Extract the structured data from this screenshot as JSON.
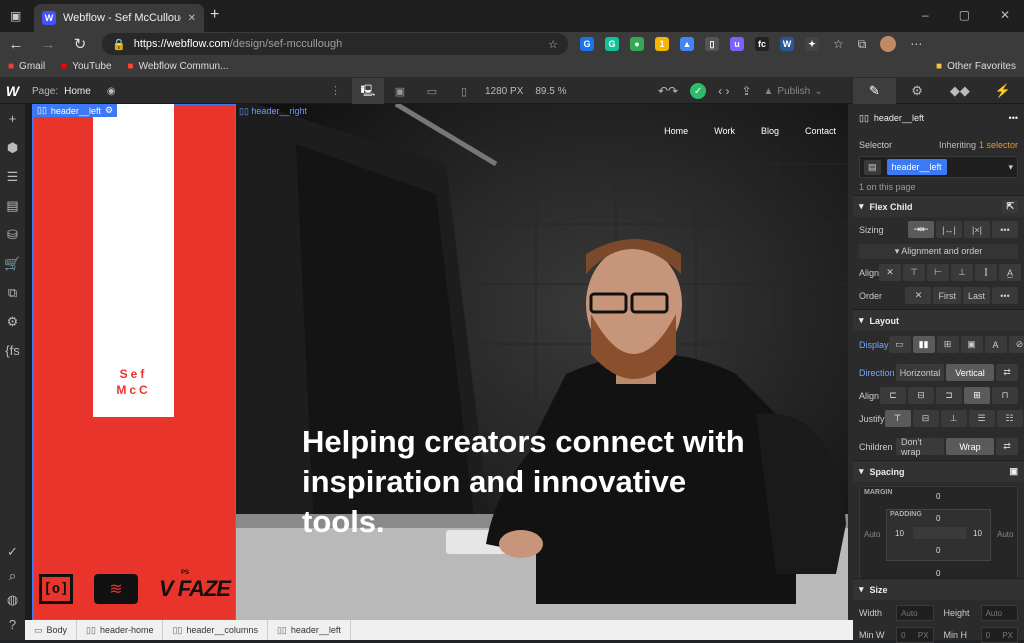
{
  "browser": {
    "tab_title": "Webflow - Sef McCullough",
    "tab_favicon": "W",
    "new_tab": "+",
    "close": "✕",
    "url_domain": "https://webflow.com",
    "url_path": "/design/sef-mccullough",
    "bookmarks": [
      {
        "label": "Gmail",
        "icon": "gmail-icon",
        "color": "#ea4335"
      },
      {
        "label": "YouTube",
        "icon": "youtube-icon",
        "color": "#ff0000"
      },
      {
        "label": "Webflow Commun...",
        "icon": "webflow-community-icon",
        "color": "#ff4433"
      }
    ],
    "other_favorites": "Other Favorites",
    "extensions": [
      {
        "icon": "g-ext-icon",
        "glyph": "G",
        "color": "#1a73e8"
      },
      {
        "icon": "grammarly-icon",
        "glyph": "G",
        "color": "#15c39a"
      },
      {
        "icon": "dot-ext-icon",
        "glyph": "●",
        "color": "#34a853"
      },
      {
        "icon": "badge-ext-icon",
        "glyph": "1",
        "color": "#f4b400"
      },
      {
        "icon": "arrow-ext-icon",
        "glyph": "▲",
        "color": "#4285f4"
      },
      {
        "icon": "phone-ext-icon",
        "glyph": "▯",
        "color": "#555555"
      },
      {
        "icon": "u-ext-icon",
        "glyph": "u",
        "color": "#7b61ff"
      },
      {
        "icon": "fs-ext-icon",
        "glyph": "fc",
        "color": "#222222"
      },
      {
        "icon": "w-ext-icon",
        "glyph": "W",
        "color": "#2b579a"
      },
      {
        "icon": "puzzle-icon",
        "glyph": "✦",
        "color": "#444444"
      }
    ]
  },
  "webflow": {
    "logo": "W",
    "page_label": "Page:",
    "page_name": "Home",
    "width": "1280 PX",
    "zoom": "89.5 %",
    "publish": "Publish",
    "panel_tabs": [
      "✎",
      "⚙",
      "◆◆",
      "⚡"
    ],
    "left_tools": [
      "+",
      "⬢",
      "☰",
      "▤",
      "⛁",
      "🛒",
      "⧉",
      "⚙",
      "{fs"
    ],
    "left_bottom_tools": [
      "✓",
      "⌕",
      "◍",
      "?"
    ]
  },
  "canvas": {
    "header_left_label": "header__left",
    "header_right_label": "header__right",
    "name_line1": "Sef",
    "name_line2": "McC",
    "logos": [
      "[o]",
      "≋",
      "V FAZE"
    ],
    "logo_ps": "PS",
    "nav": [
      "Home",
      "Work",
      "Blog",
      "Contact"
    ],
    "hero": "Helping creators connect with inspiration and innovative tools."
  },
  "breadcrumbs": [
    "Body",
    "header-home",
    "header__columns",
    "header__left"
  ],
  "panel": {
    "element": "header__left",
    "selector_label": "Selector",
    "inheriting": "Inheriting",
    "inheriting_count": "1 selector",
    "selector_tag": "header__left",
    "on_page": "1 on this page",
    "flex_child": "Flex Child",
    "sizing": "Sizing",
    "sizing_opts": [
      "⇥⇤",
      "|↔|",
      "|×|",
      "•••"
    ],
    "align_order": "Alignment and order",
    "align": "Align",
    "align_opts": [
      "✕",
      "⊤",
      "⊢",
      "⊥",
      "⫿",
      "A̲"
    ],
    "order": "Order",
    "order_opts": [
      "✕",
      "First",
      "Last",
      "•••"
    ],
    "layout": "Layout",
    "display": "Display",
    "display_opts": [
      "▭",
      "▮▮",
      "⊞",
      "▣",
      "A",
      "⊘"
    ],
    "direction": "Direction",
    "direction_opts": [
      "Horizontal",
      "Vertical"
    ],
    "align_opts2": [
      "⊏",
      "⊟",
      "⊐",
      "⊞",
      "⊓"
    ],
    "justify": "Justify",
    "justify_opts": [
      "⊤",
      "⊟",
      "⊥",
      "☰",
      "☷"
    ],
    "children": "Children",
    "children_opts": [
      "Don't wrap",
      "Wrap"
    ],
    "spacing": "Spacing",
    "margin_label": "MARGIN",
    "padding_label": "PADDING",
    "margin": {
      "top": "0",
      "bottom": "0",
      "left": "Auto",
      "right": "Auto"
    },
    "padding": {
      "top": "0",
      "bottom": "0",
      "left": "10",
      "right": "10"
    },
    "size": "Size",
    "width_label": "Width",
    "height_label": "Height",
    "width_val": "Auto",
    "height_val": "Auto",
    "min_w": "Min W",
    "min_h": "Min H",
    "min_val": "0",
    "unit": "PX"
  }
}
